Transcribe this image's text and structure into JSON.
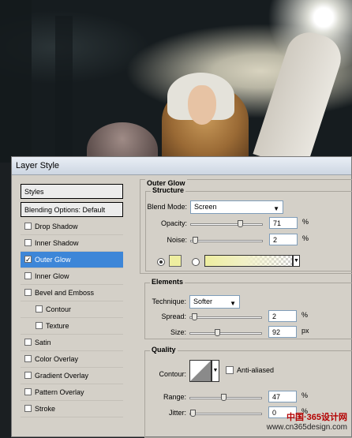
{
  "window": {
    "title": "Layer Style"
  },
  "sidebar": {
    "styles_label": "Styles",
    "blending_label": "Blending Options: Default",
    "items": [
      {
        "label": "Drop Shadow",
        "checked": false,
        "selected": false
      },
      {
        "label": "Inner Shadow",
        "checked": false,
        "selected": false
      },
      {
        "label": "Outer Glow",
        "checked": true,
        "selected": true
      },
      {
        "label": "Inner Glow",
        "checked": false,
        "selected": false
      },
      {
        "label": "Bevel and Emboss",
        "checked": false,
        "selected": false
      },
      {
        "label": "Contour",
        "checked": false,
        "selected": false,
        "sub": true
      },
      {
        "label": "Texture",
        "checked": false,
        "selected": false,
        "sub": true
      },
      {
        "label": "Satin",
        "checked": false,
        "selected": false
      },
      {
        "label": "Color Overlay",
        "checked": false,
        "selected": false
      },
      {
        "label": "Gradient Overlay",
        "checked": false,
        "selected": false
      },
      {
        "label": "Pattern Overlay",
        "checked": false,
        "selected": false
      },
      {
        "label": "Stroke",
        "checked": false,
        "selected": false
      }
    ]
  },
  "panel": {
    "title": "Outer Glow",
    "structure": {
      "legend": "Structure",
      "blend_mode_label": "Blend Mode:",
      "blend_mode_value": "Screen",
      "opacity_label": "Opacity:",
      "opacity_value": "71",
      "opacity_level": 0.71,
      "noise_label": "Noise:",
      "noise_value": "2",
      "noise_level": 0.02,
      "percent": "%",
      "glow_color": "#eeeea0"
    },
    "elements": {
      "legend": "Elements",
      "technique_label": "Technique:",
      "technique_value": "Softer",
      "spread_label": "Spread:",
      "spread_value": "2",
      "spread_level": 0.02,
      "size_label": "Size:",
      "size_value": "92",
      "size_level": 0.37,
      "percent": "%",
      "px": "px"
    },
    "quality": {
      "legend": "Quality",
      "contour_label": "Contour:",
      "antialiased_label": "Anti-aliased",
      "range_label": "Range:",
      "range_value": "47",
      "range_level": 0.47,
      "jitter_label": "Jitter:",
      "jitter_value": "0",
      "jitter_level": 0.0,
      "percent": "%"
    }
  },
  "watermark": {
    "line1": "中国·365设计网",
    "line2": "www.cn365design.com"
  }
}
